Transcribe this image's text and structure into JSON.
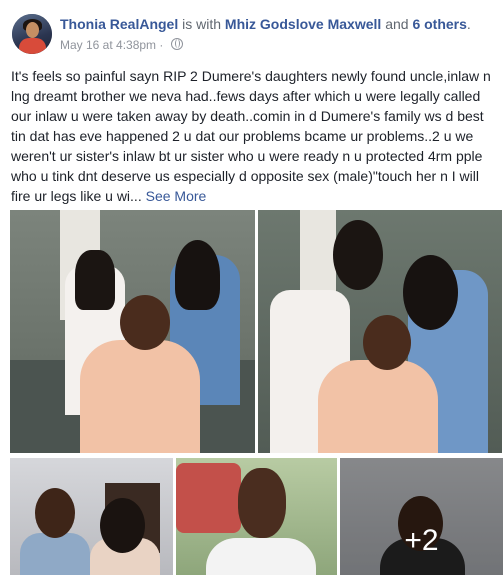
{
  "post": {
    "author": "Thonia RealAngel",
    "with_text": "is with",
    "tagged_name": "Mhiz Godslove Maxwell",
    "and_text": "and",
    "others": "6 others",
    "period": ".",
    "timestamp": "May 16 at 4:38pm",
    "separator": "·",
    "privacy_icon": "globe-icon",
    "text": "It's feels so painful sayn RIP 2 Dumere's daughters newly found uncle,inlaw n lng dreamt brother we neva had..fews days after which u were legally called our inlaw u were taken away by death..comin in d Dumere's family ws d best tin dat has eve happened 2 u dat our problems bcame ur problems..2 u we weren't ur sister's inlaw bt ur sister who u were ready n u protected 4rm pple who u tink dnt deserve us especially d opposite sex (male)\"touch her n I will fire ur legs like u wi...",
    "see_more": "See More"
  },
  "photos": {
    "more_count": "+2"
  },
  "colors": {
    "link": "#385898",
    "text": "#1d2129",
    "meta": "#90949c"
  }
}
